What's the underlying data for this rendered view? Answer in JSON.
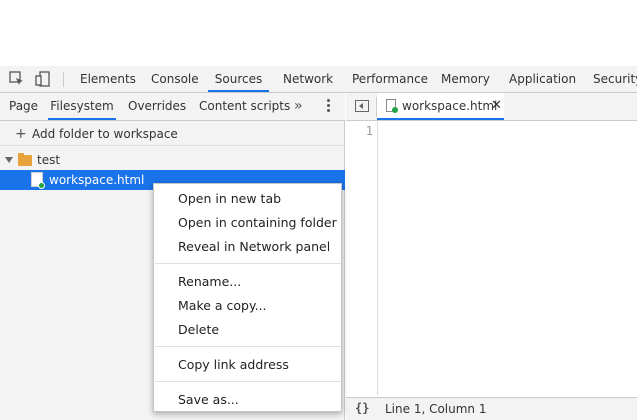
{
  "main_tabs": [
    {
      "label": "Elements"
    },
    {
      "label": "Console"
    },
    {
      "label": "Sources"
    },
    {
      "label": "Network"
    },
    {
      "label": "Performance"
    },
    {
      "label": "Memory"
    },
    {
      "label": "Application"
    },
    {
      "label": "Security"
    }
  ],
  "active_main_tab": "Sources",
  "navigator": {
    "tabs": [
      {
        "label": "Page"
      },
      {
        "label": "Filesystem"
      },
      {
        "label": "Overrides"
      },
      {
        "label": "Content scripts"
      }
    ],
    "more_icon": "»",
    "add_folder_label": "Add folder to workspace",
    "add_icon": "+",
    "tree": {
      "folder": "test",
      "file": "workspace.html"
    }
  },
  "editor": {
    "tab_label": "workspace.html",
    "close_glyph": "✕",
    "line_number": "1"
  },
  "statusbar": {
    "format_icon": "{}",
    "cursor": "Line 1, Column 1"
  },
  "context_menu": {
    "group1": [
      "Open in new tab",
      "Open in containing folder",
      "Reveal in Network panel"
    ],
    "group2": [
      "Rename...",
      "Make a copy...",
      "Delete"
    ],
    "group3": [
      "Copy link address"
    ],
    "group4": [
      "Save as..."
    ]
  },
  "colors": {
    "accent": "#1a73e8",
    "folder": "#e8a33a",
    "file_status": "#1ea446"
  }
}
